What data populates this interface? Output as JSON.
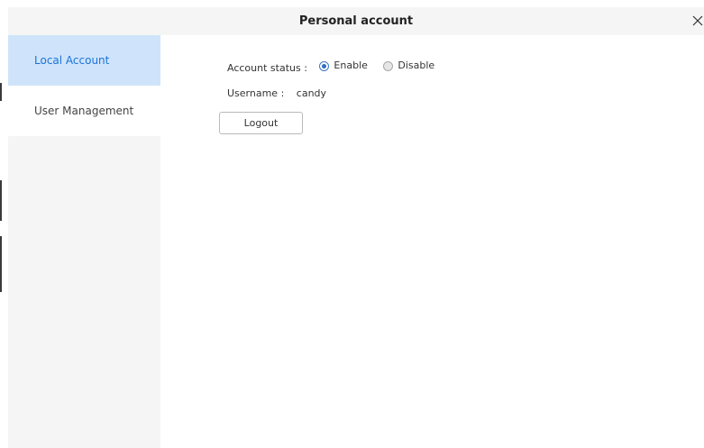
{
  "window": {
    "title": "Personal account",
    "close_icon": "close-icon"
  },
  "sidebar": {
    "items": [
      {
        "label": "Local Account",
        "active": true
      },
      {
        "label": "User Management",
        "active": false
      }
    ]
  },
  "account": {
    "status_label": "Account status :",
    "status_options": [
      {
        "label": "Enable",
        "selected": true
      },
      {
        "label": "Disable",
        "selected": false
      }
    ],
    "username_label": "Username :",
    "username_value": "candy",
    "logout_label": "Logout"
  },
  "colors": {
    "accent": "#1a73d9",
    "active_bg": "#cfe4fb",
    "sidebar_bg": "#f5f5f5"
  }
}
